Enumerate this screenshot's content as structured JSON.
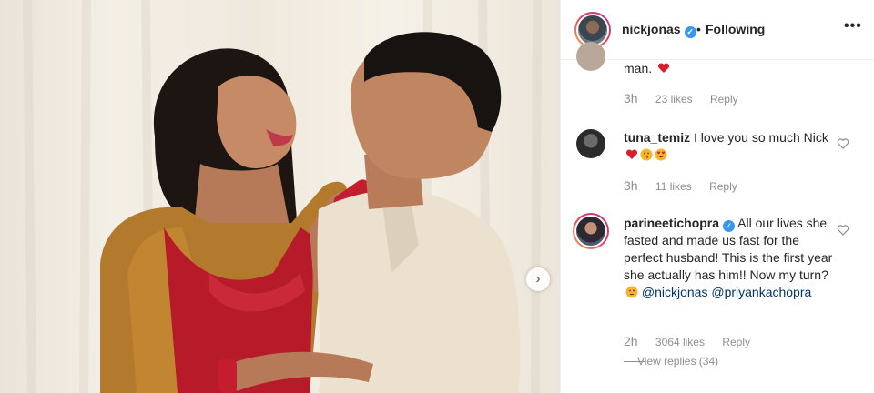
{
  "post": {
    "username": "nickjonas",
    "separator": "•",
    "follow_status": "Following",
    "more_label": "•••",
    "next_arrow": "›"
  },
  "icons": {
    "verified": "verified-badge-icon",
    "heart": "heart-outline-icon",
    "next": "chevron-right-icon",
    "more": "more-options-icon"
  },
  "colors": {
    "verified_blue": "#3897f0",
    "link_blue": "#003569",
    "meta_grey": "#8e8e8e",
    "text": "#262626"
  },
  "comments": [
    {
      "text_end": "man.",
      "time": "3h",
      "likes": "23 likes",
      "reply": "Reply"
    },
    {
      "username": "tuna_temiz",
      "text": "I love you so much Nick",
      "time": "3h",
      "likes": "11 likes",
      "reply": "Reply"
    },
    {
      "username": "parineetichopra",
      "text": "All our lives she fasted and made us fast for the perfect husband! This is the first year she actually has him!! Now my turn?",
      "mention1": "@nickjonas",
      "mention2": "@priyankachopra",
      "time": "2h",
      "likes": "3064 likes",
      "reply": "Reply",
      "view_replies": "View replies (34)"
    }
  ]
}
